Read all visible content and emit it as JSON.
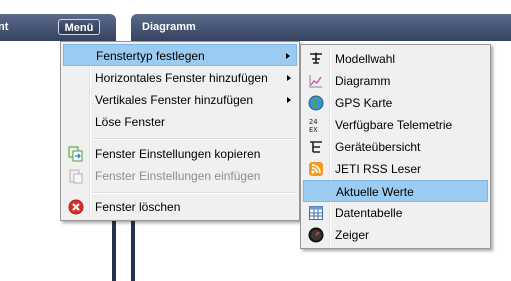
{
  "left_panel": {
    "title": "nt",
    "menu_button": "Menü"
  },
  "right_panel": {
    "title": "Diagramm"
  },
  "context_menu": {
    "items": [
      {
        "label": "Fenstertyp festlegen",
        "submenu": true,
        "highlighted": true,
        "icon": ""
      },
      {
        "label": "Horizontales Fenster hinzufügen",
        "submenu": true,
        "icon": ""
      },
      {
        "label": "Vertikales Fenster hinzufügen",
        "submenu": true,
        "icon": ""
      },
      {
        "label": "Löse Fenster",
        "icon": ""
      },
      {
        "label": "Fenster Einstellungen kopieren",
        "icon": "copy-settings-icon"
      },
      {
        "label": "Fenster Einstellungen einfügen",
        "disabled": true,
        "icon": "paste-settings-icon"
      },
      {
        "label": "Fenster löschen",
        "icon": "delete-icon"
      }
    ]
  },
  "submenu": {
    "items": [
      {
        "label": "Modellwahl",
        "icon": "model-select-icon"
      },
      {
        "label": "Diagramm",
        "icon": "chart-icon"
      },
      {
        "label": "GPS Karte",
        "icon": "globe-icon"
      },
      {
        "label": "Verfügbare Telemetrie",
        "icon": "telemetry-icon"
      },
      {
        "label": "Geräteübersicht",
        "icon": "device-tree-icon"
      },
      {
        "label": "JETI RSS Leser",
        "icon": "rss-icon"
      },
      {
        "label": "Aktuelle Werte",
        "highlighted": true,
        "icon": ""
      },
      {
        "label": "Datentabelle",
        "icon": "table-icon"
      },
      {
        "label": "Zeiger",
        "icon": "gauge-icon"
      }
    ]
  },
  "colors": {
    "highlight": "#9ccbf2",
    "header": "#35435f",
    "menu_bg": "#f0f0f0"
  }
}
